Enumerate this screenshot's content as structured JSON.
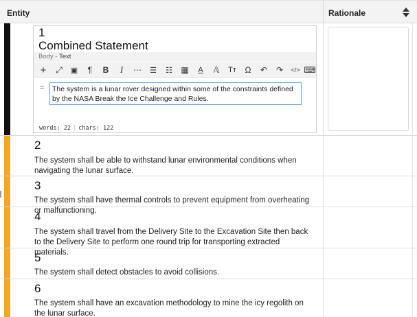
{
  "header": {
    "entity_label": "Entity",
    "rationale_label": "Rationale",
    "sort_icon": "sort-updown-icon"
  },
  "editor": {
    "number": "1",
    "title": "Combined Statement",
    "breadcrumb_parent": "Body",
    "breadcrumb_sep": " - ",
    "breadcrumb_current": "Text",
    "text": "The system is a lunar rover designed within some of the constraints defined by the NASA Break the Ice Challenge and Rules.",
    "drag_glyph": "=",
    "words_label": "words: 22",
    "chars_label": "chars: 122",
    "toolbar": [
      {
        "name": "add-icon",
        "glyph": "+"
      },
      {
        "name": "fullscreen-icon",
        "glyph": "⤢"
      },
      {
        "name": "comment-icon",
        "glyph": "▣"
      },
      {
        "name": "paragraph-icon",
        "glyph": "¶"
      },
      {
        "name": "bold-icon",
        "glyph": "B"
      },
      {
        "name": "italic-icon",
        "glyph": "I"
      },
      {
        "name": "more-icon",
        "glyph": "⋯"
      },
      {
        "name": "align-icon",
        "glyph": "☰"
      },
      {
        "name": "list-icon",
        "glyph": "☷"
      },
      {
        "name": "table-icon",
        "glyph": "▦"
      },
      {
        "name": "font-color-icon",
        "glyph": "A"
      },
      {
        "name": "font-style-icon",
        "glyph": "𝔸"
      },
      {
        "name": "text-size-icon",
        "glyph": "Tт"
      },
      {
        "name": "special-char-icon",
        "glyph": "Ω"
      },
      {
        "name": "undo-icon",
        "glyph": "↶"
      },
      {
        "name": "redo-icon",
        "glyph": "↷"
      },
      {
        "name": "code-icon",
        "glyph": "</>"
      },
      {
        "name": "keyboard-icon",
        "glyph": "⌨"
      }
    ]
  },
  "rows": [
    {
      "number": "2",
      "text": "The system shall be able to withstand lunar environmental conditions when navigating the lunar surface."
    },
    {
      "number": "3",
      "text": "The system shall have thermal controls to prevent equipment from overheating or malfunctioning."
    },
    {
      "number": "4",
      "text": "The system shall travel from the Delivery Site to the Excavation Site then back to the Delivery Site to perform one round trip for transporting extracted materials."
    },
    {
      "number": "5",
      "text": "The system shall detect obstacles to avoid collisions."
    },
    {
      "number": "6",
      "text": "The system shall have an excavation methodology to mine the icy regolith on the lunar surface."
    }
  ],
  "colors": {
    "row1_bar": "#111111",
    "row_bar": "#f5a623",
    "focus_border": "#5a9fe0"
  }
}
